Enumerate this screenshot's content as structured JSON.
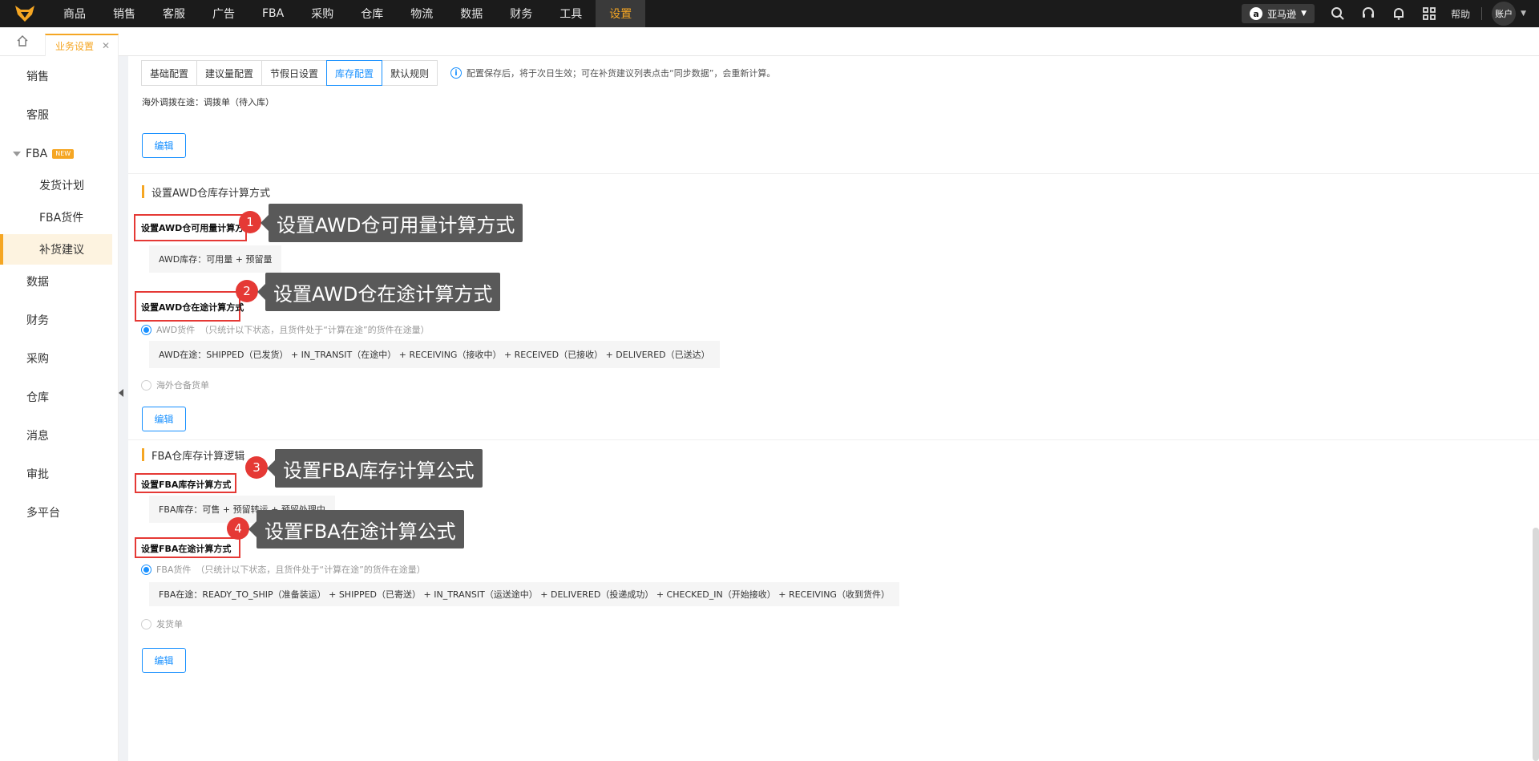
{
  "nav": {
    "items": [
      "商品",
      "销售",
      "客服",
      "广告",
      "FBA",
      "采购",
      "仓库",
      "物流",
      "数据",
      "财务",
      "工具",
      "设置"
    ],
    "active_index": 11,
    "shop_label": "亚马逊",
    "help_label": "帮助",
    "account_label": "账户"
  },
  "tabs": {
    "page_tab": "业务设置"
  },
  "sidebar": {
    "sales": "销售",
    "service": "客服",
    "fba": "FBA",
    "fba_badge": "NEW",
    "fba_children": [
      "发货计划",
      "FBA货件",
      "补货建议"
    ],
    "active_child_index": 2,
    "data": "数据",
    "finance": "财务",
    "purchase": "采购",
    "warehouse": "仓库",
    "message": "消息",
    "approval": "审批",
    "multi": "多平台"
  },
  "subtabs": [
    "基础配置",
    "建议量配置",
    "节假日设置",
    "库存配置",
    "默认规则"
  ],
  "subtab_active_index": 3,
  "tip": "配置保存后，将于次日生效；可在补货建议列表点击“同步数据”，会重新计算。",
  "top_text": "海外调拨在途：调拨单（待入库）",
  "edit_label": "编辑",
  "awd": {
    "title": "设置AWD仓库存计算方式",
    "usable_heading": "设置AWD仓可用量计算方式",
    "usable_formula": "AWD库存：可用量 + 预留量",
    "transit_heading": "设置AWD仓在途计算方式",
    "radio1_label": "AWD货件",
    "radio1_note": "（只统计以下状态，且货件处于“计算在途”的货件在途量）",
    "transit_formula": "AWD在途：SHIPPED（已发货） + IN_TRANSIT（在途中） + RECEIVING（接收中） + RECEIVED（已接收） + DELIVERED（已送达）",
    "radio2_label": "海外仓备货单"
  },
  "fba_sec": {
    "title": "FBA仓库存计算逻辑",
    "stock_heading": "设置FBA库存计算方式",
    "stock_formula": "FBA库存：可售 + 预留转运 + 预留处理中",
    "transit_heading": "设置FBA在途计算方式",
    "radio1_label": "FBA货件",
    "radio1_note": "（只统计以下状态，且货件处于“计算在途”的货件在途量）",
    "transit_formula": "FBA在途：READY_TO_SHIP（准备装运） + SHIPPED（已寄送） + IN_TRANSIT（运送途中） + DELIVERED（投递成功） + CHECKED_IN（开始接收） + RECEIVING（收到货件）",
    "radio2_label": "发货单"
  },
  "callouts": [
    {
      "num": "1",
      "text": "设置AWD仓可用量计算方式"
    },
    {
      "num": "2",
      "text": "设置AWD仓在途计算方式"
    },
    {
      "num": "3",
      "text": "设置FBA库存计算公式"
    },
    {
      "num": "4",
      "text": "设置FBA在途计算公式"
    }
  ],
  "colors": {
    "accent": "#f5a623",
    "link": "#1890ff",
    "annotation_red": "#e53935",
    "callout_bg": "#595959"
  }
}
